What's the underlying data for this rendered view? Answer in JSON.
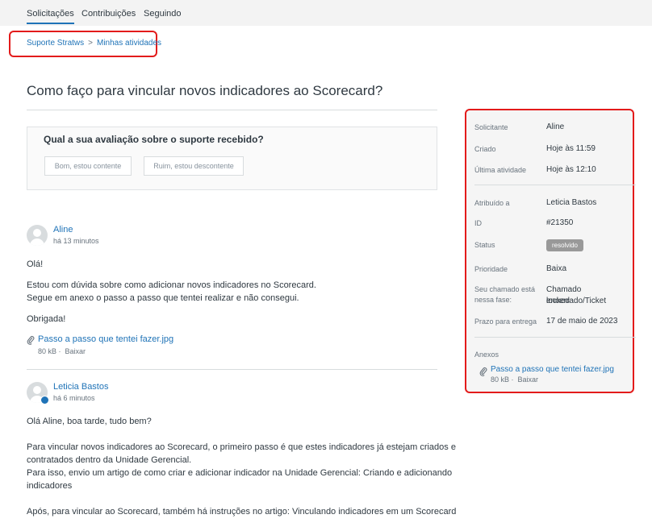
{
  "nav": {
    "tabs": [
      {
        "label": "Solicitações"
      },
      {
        "label": "Contribuições"
      },
      {
        "label": "Seguindo"
      }
    ]
  },
  "breadcrumb": {
    "items": [
      {
        "label": "Suporte Stratws"
      },
      {
        "label": "Minhas atividades"
      }
    ],
    "separator": ">"
  },
  "request": {
    "title": "Como faço para vincular novos indicadores ao Scorecard?"
  },
  "rating": {
    "question": "Qual a sua avaliação sobre o suporte recebido?",
    "good_label": "Bom, estou contente",
    "bad_label": "Ruim, estou descontente"
  },
  "comments": [
    {
      "author": "Aline",
      "time": "há 13 minutos",
      "paragraphs": [
        "Olá!",
        "Estou com dúvida sobre como adicionar novos indicadores no Scorecard.",
        "Segue em anexo o passo a passo que tentei realizar e não consegui.",
        "Obrigada!"
      ],
      "attachment": {
        "name": "Passo a passo que tentei fazer.jpg",
        "size": "80 kB",
        "download": "Baixar"
      }
    },
    {
      "author": "Leticia Bastos",
      "time": "há 6 minutos",
      "paragraphs": [
        "Olá Aline, boa tarde, tudo bem?",
        "Para vincular novos indicadores ao Scorecard, o primeiro passo é que estes indicadores já estejam criados e",
        "contratados dentro da Unidade Gerencial.",
        "Para isso, envio um artigo de como criar e adicionar indicador na Unidade Gerencial: Criando e adicionando",
        "indicadores",
        "Após, para vincular ao Scorecard, também há instruções no artigo: Vinculando indicadores em um Scorecard"
      ]
    }
  ],
  "sidebar": {
    "requester": {
      "label": "Solicitante",
      "value": "Aline"
    },
    "created": {
      "label": "Criado",
      "value": "Hoje às 11:59"
    },
    "last_activity": {
      "label": "Última atividade",
      "value": "Hoje às 12:10"
    },
    "assignee": {
      "label": "Atribuído a",
      "value": "Leticia Bastos"
    },
    "id": {
      "label": "ID",
      "value": "#21350"
    },
    "status": {
      "label": "Status",
      "value": "resolvido"
    },
    "priority": {
      "label": "Prioridade",
      "value": "Baixa"
    },
    "ticket_state": {
      "label_line1": "Seu chamado está",
      "label_line2": "nessa fase:",
      "value_line1": "Chamado encerrado/Ticket",
      "value_line2": "locked"
    },
    "due": {
      "label": "Prazo para entrega",
      "value": "17 de maio de 2023"
    },
    "attachments": {
      "label": "Anexos",
      "name": "Passo a passo que tentei fazer.jpg",
      "size": "80 kB",
      "download": "Baixar"
    }
  },
  "colors": {
    "accent": "#1f73b7",
    "highlight": "#e31b1b",
    "status_badge": "#999999"
  },
  "icons": {
    "attachment": "paperclip-icon",
    "avatar": "user-avatar-icon",
    "agent_badge": "agent-badge-icon"
  }
}
